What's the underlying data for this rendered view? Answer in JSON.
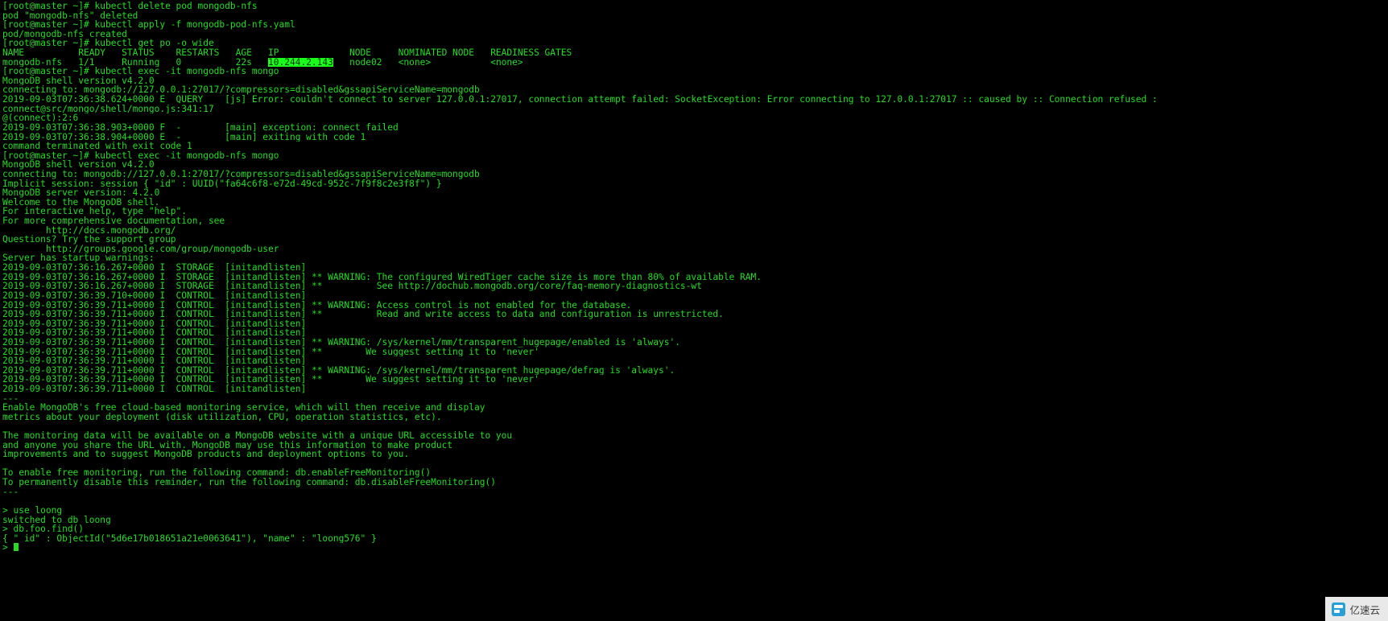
{
  "terminal": {
    "background_color": "#000000",
    "foreground_color": "#22dd22",
    "highlight_background_color": "#1aff1a",
    "highlight_foreground_color": "#003300",
    "prompt": "[root@master ~]#",
    "shell_prompt": ">",
    "highlight_text": "10.244.2.143",
    "lines": [
      {
        "id": 0,
        "text": "[root@master ~]# kubectl delete pod mongodb-nfs"
      },
      {
        "id": 1,
        "text": "pod \"mongodb-nfs\" deleted"
      },
      {
        "id": 2,
        "text": "[root@master ~]# kubectl apply -f mongodb-pod-nfs.yaml"
      },
      {
        "id": 3,
        "text": "pod/mongodb-nfs created"
      },
      {
        "id": 4,
        "text": "[root@master ~]# kubectl get po -o wide"
      },
      {
        "id": 5,
        "text": "NAME          READY   STATUS    RESTARTS   AGE   IP             NODE     NOMINATED NODE   READINESS GATES"
      },
      {
        "id": 6,
        "pre": "mongodb-nfs   1/1     Running   0          22s   ",
        "hl": "10.244.2.143",
        "post": "   node02   <none>           <none>"
      },
      {
        "id": 7,
        "text": "[root@master ~]# kubectl exec -it mongodb-nfs mongo"
      },
      {
        "id": 8,
        "text": "MongoDB shell version v4.2.0"
      },
      {
        "id": 9,
        "text": "connecting to: mongodb://127.0.0.1:27017/?compressors=disabled&gssapiServiceName=mongodb"
      },
      {
        "id": 10,
        "text": "2019-09-03T07:36:38.624+0000 E  QUERY    [js] Error: couldn't connect to server 127.0.0.1:27017, connection attempt failed: SocketException: Error connecting to 127.0.0.1:27017 :: caused by :: Connection refused :"
      },
      {
        "id": 11,
        "text": "connect@src/mongo/shell/mongo.js:341:17"
      },
      {
        "id": 12,
        "text": "@(connect):2:6"
      },
      {
        "id": 13,
        "text": "2019-09-03T07:36:38.903+0000 F  -        [main] exception: connect failed"
      },
      {
        "id": 14,
        "text": "2019-09-03T07:36:38.904+0000 E  -        [main] exiting with code 1"
      },
      {
        "id": 15,
        "text": "command terminated with exit code 1"
      },
      {
        "id": 16,
        "text": "[root@master ~]# kubectl exec -it mongodb-nfs mongo"
      },
      {
        "id": 17,
        "text": "MongoDB shell version v4.2.0"
      },
      {
        "id": 18,
        "text": "connecting to: mongodb://127.0.0.1:27017/?compressors=disabled&gssapiServiceName=mongodb"
      },
      {
        "id": 19,
        "text": "Implicit session: session { \"id\" : UUID(\"fa64c6f8-e72d-49cd-952c-7f9f8c2e3f8f\") }"
      },
      {
        "id": 20,
        "text": "MongoDB server version: 4.2.0"
      },
      {
        "id": 21,
        "text": "Welcome to the MongoDB shell."
      },
      {
        "id": 22,
        "text": "For interactive help, type \"help\"."
      },
      {
        "id": 23,
        "text": "For more comprehensive documentation, see"
      },
      {
        "id": 24,
        "text": "        http://docs.mongodb.org/"
      },
      {
        "id": 25,
        "text": "Questions? Try the support group"
      },
      {
        "id": 26,
        "text": "        http://groups.google.com/group/mongodb-user"
      },
      {
        "id": 27,
        "text": "Server has startup warnings:"
      },
      {
        "id": 28,
        "text": "2019-09-03T07:36:16.267+0000 I  STORAGE  [initandlisten]"
      },
      {
        "id": 29,
        "text": "2019-09-03T07:36:16.267+0000 I  STORAGE  [initandlisten] ** WARNING: The configured WiredTiger cache size is more than 80% of available RAM."
      },
      {
        "id": 30,
        "text": "2019-09-03T07:36:16.267+0000 I  STORAGE  [initandlisten] **          See http://dochub.mongodb.org/core/faq-memory-diagnostics-wt"
      },
      {
        "id": 31,
        "text": "2019-09-03T07:36:39.710+0000 I  CONTROL  [initandlisten]"
      },
      {
        "id": 32,
        "text": "2019-09-03T07:36:39.711+0000 I  CONTROL  [initandlisten] ** WARNING: Access control is not enabled for the database."
      },
      {
        "id": 33,
        "text": "2019-09-03T07:36:39.711+0000 I  CONTROL  [initandlisten] **          Read and write access to data and configuration is unrestricted."
      },
      {
        "id": 34,
        "text": "2019-09-03T07:36:39.711+0000 I  CONTROL  [initandlisten]"
      },
      {
        "id": 35,
        "text": "2019-09-03T07:36:39.711+0000 I  CONTROL  [initandlisten]"
      },
      {
        "id": 36,
        "text": "2019-09-03T07:36:39.711+0000 I  CONTROL  [initandlisten] ** WARNING: /sys/kernel/mm/transparent_hugepage/enabled is 'always'."
      },
      {
        "id": 37,
        "text": "2019-09-03T07:36:39.711+0000 I  CONTROL  [initandlisten] **        We suggest setting it to 'never'"
      },
      {
        "id": 38,
        "text": "2019-09-03T07:36:39.711+0000 I  CONTROL  [initandlisten]"
      },
      {
        "id": 39,
        "text": "2019-09-03T07:36:39.711+0000 I  CONTROL  [initandlisten] ** WARNING: /sys/kernel/mm/transparent_hugepage/defrag is 'always'."
      },
      {
        "id": 40,
        "text": "2019-09-03T07:36:39.711+0000 I  CONTROL  [initandlisten] **        We suggest setting it to 'never'"
      },
      {
        "id": 41,
        "text": "2019-09-03T07:36:39.711+0000 I  CONTROL  [initandlisten]"
      },
      {
        "id": 42,
        "text": "---"
      },
      {
        "id": 43,
        "text": "Enable MongoDB's free cloud-based monitoring service, which will then receive and display"
      },
      {
        "id": 44,
        "text": "metrics about your deployment (disk utilization, CPU, operation statistics, etc)."
      },
      {
        "id": 45,
        "text": ""
      },
      {
        "id": 46,
        "text": "The monitoring data will be available on a MongoDB website with a unique URL accessible to you"
      },
      {
        "id": 47,
        "text": "and anyone you share the URL with. MongoDB may use this information to make product"
      },
      {
        "id": 48,
        "text": "improvements and to suggest MongoDB products and deployment options to you."
      },
      {
        "id": 49,
        "text": ""
      },
      {
        "id": 50,
        "text": "To enable free monitoring, run the following command: db.enableFreeMonitoring()"
      },
      {
        "id": 51,
        "text": "To permanently disable this reminder, run the following command: db.disableFreeMonitoring()"
      },
      {
        "id": 52,
        "text": "---"
      },
      {
        "id": 53,
        "text": ""
      },
      {
        "id": 54,
        "text": "> use loong"
      },
      {
        "id": 55,
        "text": "switched to db loong"
      },
      {
        "id": 56,
        "text": "> db.foo.find()"
      },
      {
        "id": 57,
        "text": "{ \"_id\" : ObjectId(\"5d6e17b018651a21e0063641\"), \"name\" : \"loong576\" }"
      },
      {
        "id": 58,
        "text": ">",
        "cursor": true
      }
    ]
  },
  "watermark": {
    "label": "亿速云",
    "icon": "logo-icon"
  }
}
